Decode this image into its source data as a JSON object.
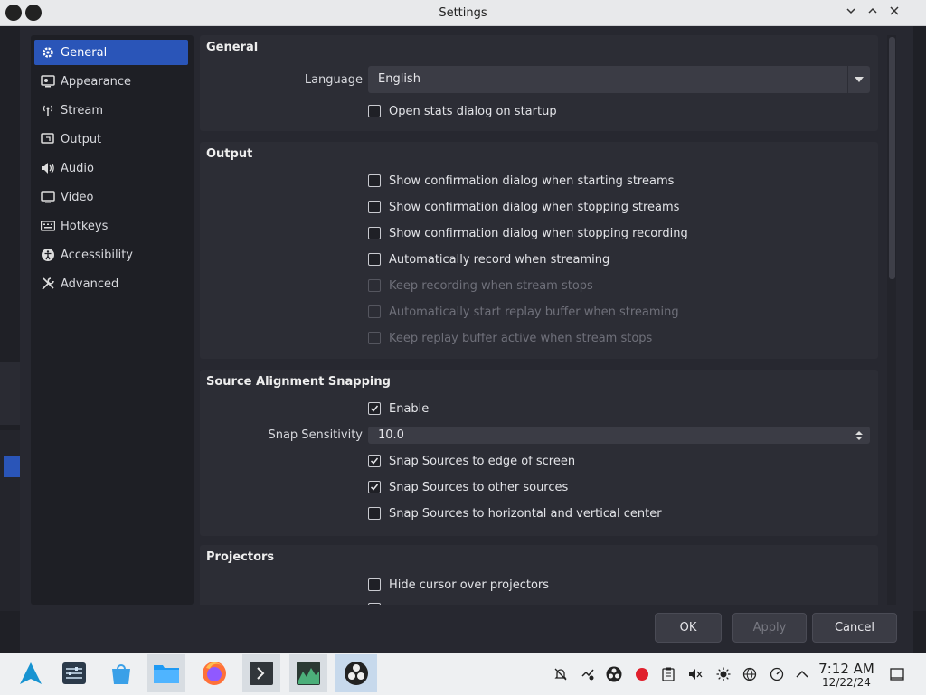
{
  "window": {
    "title": "Settings"
  },
  "sidebar": {
    "items": [
      {
        "label": "General",
        "icon": "gear-icon",
        "active": true
      },
      {
        "label": "Appearance",
        "icon": "appearance-icon",
        "active": false
      },
      {
        "label": "Stream",
        "icon": "antenna-icon",
        "active": false
      },
      {
        "label": "Output",
        "icon": "output-icon",
        "active": false
      },
      {
        "label": "Audio",
        "icon": "speaker-icon",
        "active": false
      },
      {
        "label": "Video",
        "icon": "monitor-icon",
        "active": false
      },
      {
        "label": "Hotkeys",
        "icon": "keyboard-icon",
        "active": false
      },
      {
        "label": "Accessibility",
        "icon": "accessibility-icon",
        "active": false
      },
      {
        "label": "Advanced",
        "icon": "tools-icon",
        "active": false
      }
    ]
  },
  "general": {
    "title": "General",
    "language_label": "Language",
    "language_value": "English",
    "open_stats_label": "Open stats dialog on startup",
    "open_stats_checked": false
  },
  "output": {
    "title": "Output",
    "options": [
      {
        "label": "Show confirmation dialog when starting streams",
        "checked": false,
        "disabled": false
      },
      {
        "label": "Show confirmation dialog when stopping streams",
        "checked": false,
        "disabled": false
      },
      {
        "label": "Show confirmation dialog when stopping recording",
        "checked": false,
        "disabled": false
      },
      {
        "label": "Automatically record when streaming",
        "checked": false,
        "disabled": false
      },
      {
        "label": "Keep recording when stream stops",
        "checked": false,
        "disabled": true
      },
      {
        "label": "Automatically start replay buffer when streaming",
        "checked": false,
        "disabled": true
      },
      {
        "label": "Keep replay buffer active when stream stops",
        "checked": false,
        "disabled": true
      }
    ]
  },
  "snapping": {
    "title": "Source Alignment Snapping",
    "enable_label": "Enable",
    "enable_checked": true,
    "sensitivity_label": "Snap Sensitivity",
    "sensitivity_value": "10.0",
    "options": [
      {
        "label": "Snap Sources to edge of screen",
        "checked": true
      },
      {
        "label": "Snap Sources to other sources",
        "checked": true
      },
      {
        "label": "Snap Sources to horizontal and vertical center",
        "checked": false
      }
    ]
  },
  "projectors": {
    "title": "Projectors",
    "hide_cursor_label": "Hide cursor over projectors",
    "hide_cursor_checked": false
  },
  "buttons": {
    "ok": "OK",
    "apply": "Apply",
    "cancel": "Cancel"
  },
  "taskbar": {
    "time": "7:12 AM",
    "date": "12/22/24"
  },
  "colors": {
    "accent": "#2a55b8",
    "panel": "#2c2d35",
    "background": "#272830"
  }
}
